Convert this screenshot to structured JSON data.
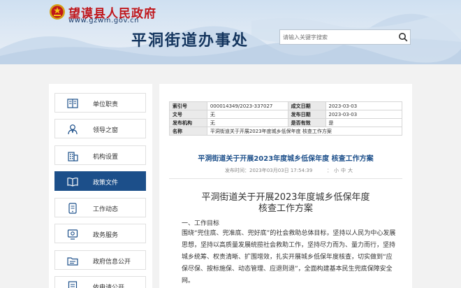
{
  "header": {
    "site_name": "望谟县人民政府",
    "site_url": "www.gzwm.gov.cn",
    "office_title": "平洞街道办事处",
    "search_placeholder": "请输入关键字搜索"
  },
  "sidebar": {
    "items": [
      {
        "label": "单位职责",
        "icon": "book-icon",
        "active": false
      },
      {
        "label": "领导之窗",
        "icon": "person-icon",
        "active": false
      },
      {
        "label": "机构设置",
        "icon": "building-icon",
        "active": false
      },
      {
        "label": "政策文件",
        "icon": "open-book-icon",
        "active": true
      },
      {
        "label": "工作动态",
        "icon": "phone-document-icon",
        "active": false
      },
      {
        "label": "政务服务",
        "icon": "service-icon",
        "active": false
      },
      {
        "label": "政府信息公开",
        "icon": "info-folder-icon",
        "active": false
      },
      {
        "label": "依申请公开",
        "icon": "request-document-icon",
        "active": false
      }
    ]
  },
  "meta": {
    "rows": [
      [
        "索引号",
        "000014349/2023-337027",
        "成文日期",
        "2023-03-03"
      ],
      [
        "文号",
        "无",
        "发布日期",
        "2023-03-03"
      ],
      [
        "发布机构",
        "无",
        "是否有效",
        "是"
      ]
    ],
    "name_key": "名称",
    "name_value": "平洞街道关于开展2023年度城乡低保年度 核查工作方案"
  },
  "doc": {
    "title": "平洞街道关于开展2023年度城乡低保年度 核查工作方案",
    "date": "发布时间：2023年03月03日 17:54:39",
    "font_label": "：",
    "font_small": "小",
    "font_medium": "中",
    "font_large": "大",
    "content_title_1": "平洞街道关于开展2023年度城乡低保年度",
    "content_title_2": "核查工作方案",
    "section_1": "一、工作目标",
    "paragraph": "围绕“兜住底、兜准底、兜好底”的社会救助总体目标，坚持以人民为中心发展思想，坚持以高质量发展统揽社会救助工作，坚持尽力而为、量力而行，坚持城乡统筹、权责清晰、扩围增效，扎实开展城乡低保年度核查，切实做到“应保尽保、按标施保、动态管理、应退则退”，全面构建基本民生兜底保障安全网。"
  },
  "colors": {
    "brand_red": "#c0161b",
    "navy": "#14355e",
    "active_nav": "#1c4f8a"
  }
}
